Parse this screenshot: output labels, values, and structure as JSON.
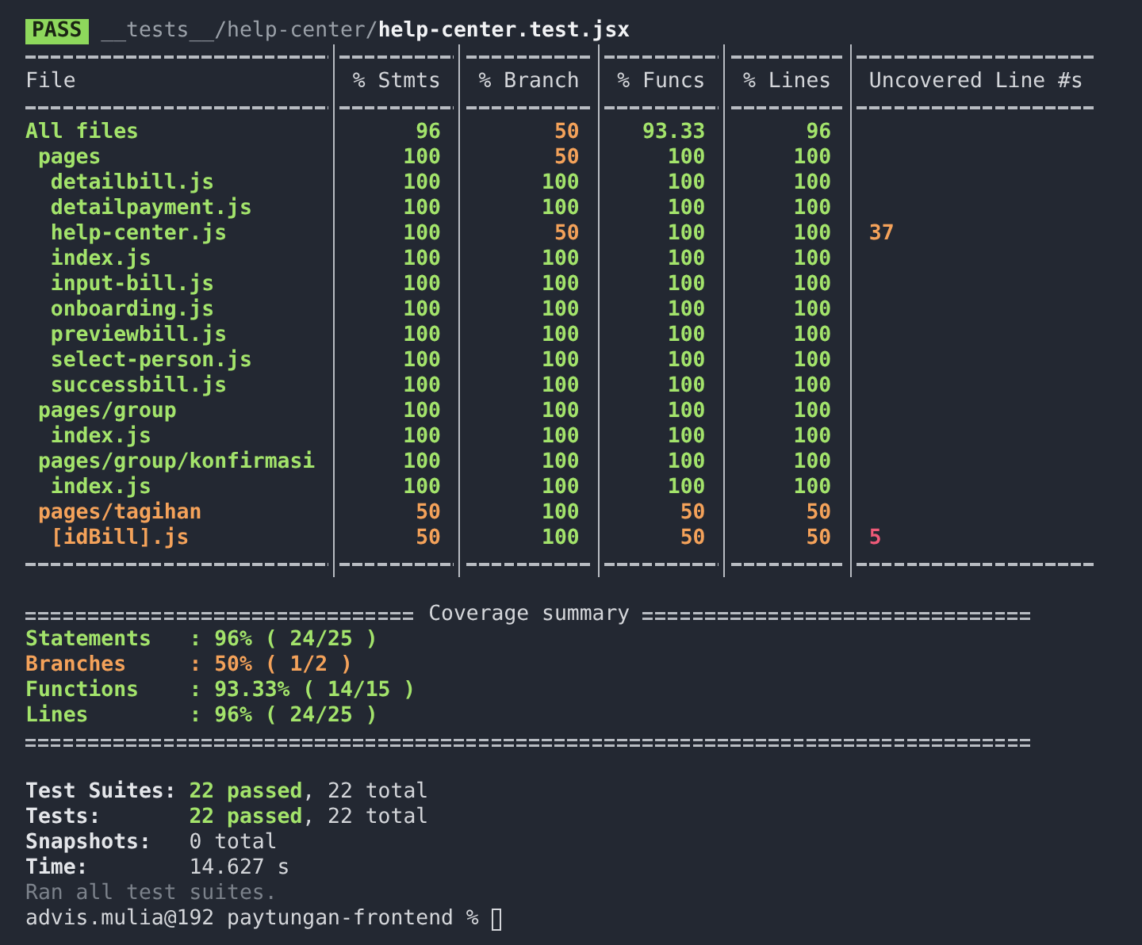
{
  "header": {
    "badge": "PASS",
    "path_dir": "__tests__/help-center/",
    "path_file": "help-center.test.jsx"
  },
  "table": {
    "columns": [
      "File",
      "% Stmts",
      "% Branch",
      "% Funcs",
      "% Lines",
      "Uncovered Line #s"
    ],
    "rows": [
      {
        "file": "All files",
        "color": "#a3e36b",
        "stmts": {
          "value": "96",
          "color": "#a3e36b"
        },
        "branch": {
          "value": "50",
          "color": "#f4a25a"
        },
        "funcs": {
          "value": "93.33",
          "color": "#a3e36b"
        },
        "lines": {
          "value": "96",
          "color": "#a3e36b"
        },
        "children": [
          {
            "file": "pages",
            "color": "#a3e36b",
            "stmts": {
              "value": "100",
              "color": "#a3e36b"
            },
            "branch": {
              "value": "50",
              "color": "#f4a25a"
            },
            "funcs": {
              "value": "100",
              "color": "#a3e36b"
            },
            "lines": {
              "value": "100",
              "color": "#a3e36b"
            },
            "children": [
              {
                "file": "detailbill.js",
                "color": "#a3e36b",
                "stmts": {
                  "value": "100",
                  "color": "#a3e36b"
                },
                "branch": {
                  "value": "100",
                  "color": "#a3e36b"
                },
                "funcs": {
                  "value": "100",
                  "color": "#a3e36b"
                },
                "lines": {
                  "value": "100",
                  "color": "#a3e36b"
                }
              },
              {
                "file": "detailpayment.js",
                "color": "#a3e36b",
                "stmts": {
                  "value": "100",
                  "color": "#a3e36b"
                },
                "branch": {
                  "value": "100",
                  "color": "#a3e36b"
                },
                "funcs": {
                  "value": "100",
                  "color": "#a3e36b"
                },
                "lines": {
                  "value": "100",
                  "color": "#a3e36b"
                }
              },
              {
                "file": "help-center.js",
                "color": "#a3e36b",
                "stmts": {
                  "value": "100",
                  "color": "#a3e36b"
                },
                "branch": {
                  "value": "50",
                  "color": "#f4a25a"
                },
                "funcs": {
                  "value": "100",
                  "color": "#a3e36b"
                },
                "lines": {
                  "value": "100",
                  "color": "#a3e36b"
                },
                "uncovered": {
                  "value": "37",
                  "color": "#f4a25a"
                }
              },
              {
                "file": "index.js",
                "color": "#a3e36b",
                "stmts": {
                  "value": "100",
                  "color": "#a3e36b"
                },
                "branch": {
                  "value": "100",
                  "color": "#a3e36b"
                },
                "funcs": {
                  "value": "100",
                  "color": "#a3e36b"
                },
                "lines": {
                  "value": "100",
                  "color": "#a3e36b"
                }
              },
              {
                "file": "input-bill.js",
                "color": "#a3e36b",
                "stmts": {
                  "value": "100",
                  "color": "#a3e36b"
                },
                "branch": {
                  "value": "100",
                  "color": "#a3e36b"
                },
                "funcs": {
                  "value": "100",
                  "color": "#a3e36b"
                },
                "lines": {
                  "value": "100",
                  "color": "#a3e36b"
                }
              },
              {
                "file": "onboarding.js",
                "color": "#a3e36b",
                "stmts": {
                  "value": "100",
                  "color": "#a3e36b"
                },
                "branch": {
                  "value": "100",
                  "color": "#a3e36b"
                },
                "funcs": {
                  "value": "100",
                  "color": "#a3e36b"
                },
                "lines": {
                  "value": "100",
                  "color": "#a3e36b"
                }
              },
              {
                "file": "previewbill.js",
                "color": "#a3e36b",
                "stmts": {
                  "value": "100",
                  "color": "#a3e36b"
                },
                "branch": {
                  "value": "100",
                  "color": "#a3e36b"
                },
                "funcs": {
                  "value": "100",
                  "color": "#a3e36b"
                },
                "lines": {
                  "value": "100",
                  "color": "#a3e36b"
                }
              },
              {
                "file": "select-person.js",
                "color": "#a3e36b",
                "stmts": {
                  "value": "100",
                  "color": "#a3e36b"
                },
                "branch": {
                  "value": "100",
                  "color": "#a3e36b"
                },
                "funcs": {
                  "value": "100",
                  "color": "#a3e36b"
                },
                "lines": {
                  "value": "100",
                  "color": "#a3e36b"
                }
              },
              {
                "file": "successbill.js",
                "color": "#a3e36b",
                "stmts": {
                  "value": "100",
                  "color": "#a3e36b"
                },
                "branch": {
                  "value": "100",
                  "color": "#a3e36b"
                },
                "funcs": {
                  "value": "100",
                  "color": "#a3e36b"
                },
                "lines": {
                  "value": "100",
                  "color": "#a3e36b"
                }
              }
            ]
          },
          {
            "file": "pages/group",
            "color": "#a3e36b",
            "stmts": {
              "value": "100",
              "color": "#a3e36b"
            },
            "branch": {
              "value": "100",
              "color": "#a3e36b"
            },
            "funcs": {
              "value": "100",
              "color": "#a3e36b"
            },
            "lines": {
              "value": "100",
              "color": "#a3e36b"
            },
            "children": [
              {
                "file": "index.js",
                "color": "#a3e36b",
                "stmts": {
                  "value": "100",
                  "color": "#a3e36b"
                },
                "branch": {
                  "value": "100",
                  "color": "#a3e36b"
                },
                "funcs": {
                  "value": "100",
                  "color": "#a3e36b"
                },
                "lines": {
                  "value": "100",
                  "color": "#a3e36b"
                }
              }
            ]
          },
          {
            "file": "pages/group/konfirmasi",
            "color": "#a3e36b",
            "stmts": {
              "value": "100",
              "color": "#a3e36b"
            },
            "branch": {
              "value": "100",
              "color": "#a3e36b"
            },
            "funcs": {
              "value": "100",
              "color": "#a3e36b"
            },
            "lines": {
              "value": "100",
              "color": "#a3e36b"
            },
            "children": [
              {
                "file": "index.js",
                "color": "#a3e36b",
                "stmts": {
                  "value": "100",
                  "color": "#a3e36b"
                },
                "branch": {
                  "value": "100",
                  "color": "#a3e36b"
                },
                "funcs": {
                  "value": "100",
                  "color": "#a3e36b"
                },
                "lines": {
                  "value": "100",
                  "color": "#a3e36b"
                }
              }
            ]
          },
          {
            "file": "pages/tagihan",
            "color": "#f4a25a",
            "stmts": {
              "value": "50",
              "color": "#f4a25a"
            },
            "branch": {
              "value": "100",
              "color": "#a3e36b"
            },
            "funcs": {
              "value": "50",
              "color": "#f4a25a"
            },
            "lines": {
              "value": "50",
              "color": "#f4a25a"
            },
            "children": [
              {
                "file": "[idBill].js",
                "color": "#f4a25a",
                "stmts": {
                  "value": "50",
                  "color": "#f4a25a"
                },
                "branch": {
                  "value": "100",
                  "color": "#a3e36b"
                },
                "funcs": {
                  "value": "50",
                  "color": "#f4a25a"
                },
                "lines": {
                  "value": "50",
                  "color": "#f4a25a"
                },
                "uncovered": {
                  "value": "5",
                  "color": "#ef5a78"
                }
              }
            ]
          }
        ]
      }
    ]
  },
  "summary": {
    "title": "Coverage summary",
    "items": [
      {
        "label": "Statements",
        "value": ": 96% ( 24/25 )",
        "color": "#a3e36b"
      },
      {
        "label": "Branches",
        "value": ": 50% ( 1/2 )",
        "color": "#f4a25a"
      },
      {
        "label": "Functions",
        "value": ": 93.33% ( 14/15 )",
        "color": "#a3e36b"
      },
      {
        "label": "Lines",
        "value": ": 96% ( 24/25 )",
        "color": "#a3e36b"
      }
    ]
  },
  "results": [
    {
      "label": "Test Suites:",
      "passed": "22 passed",
      "total": ", 22 total"
    },
    {
      "label": "Tests:",
      "passed": "22 passed",
      "total": ", 22 total"
    },
    {
      "label": "Snapshots:",
      "total": "0 total"
    },
    {
      "label": "Time:",
      "total": "14.627 s"
    }
  ],
  "footer": "Ran all test suites.",
  "prompt": "advis.mulia@192 paytungan-frontend %"
}
